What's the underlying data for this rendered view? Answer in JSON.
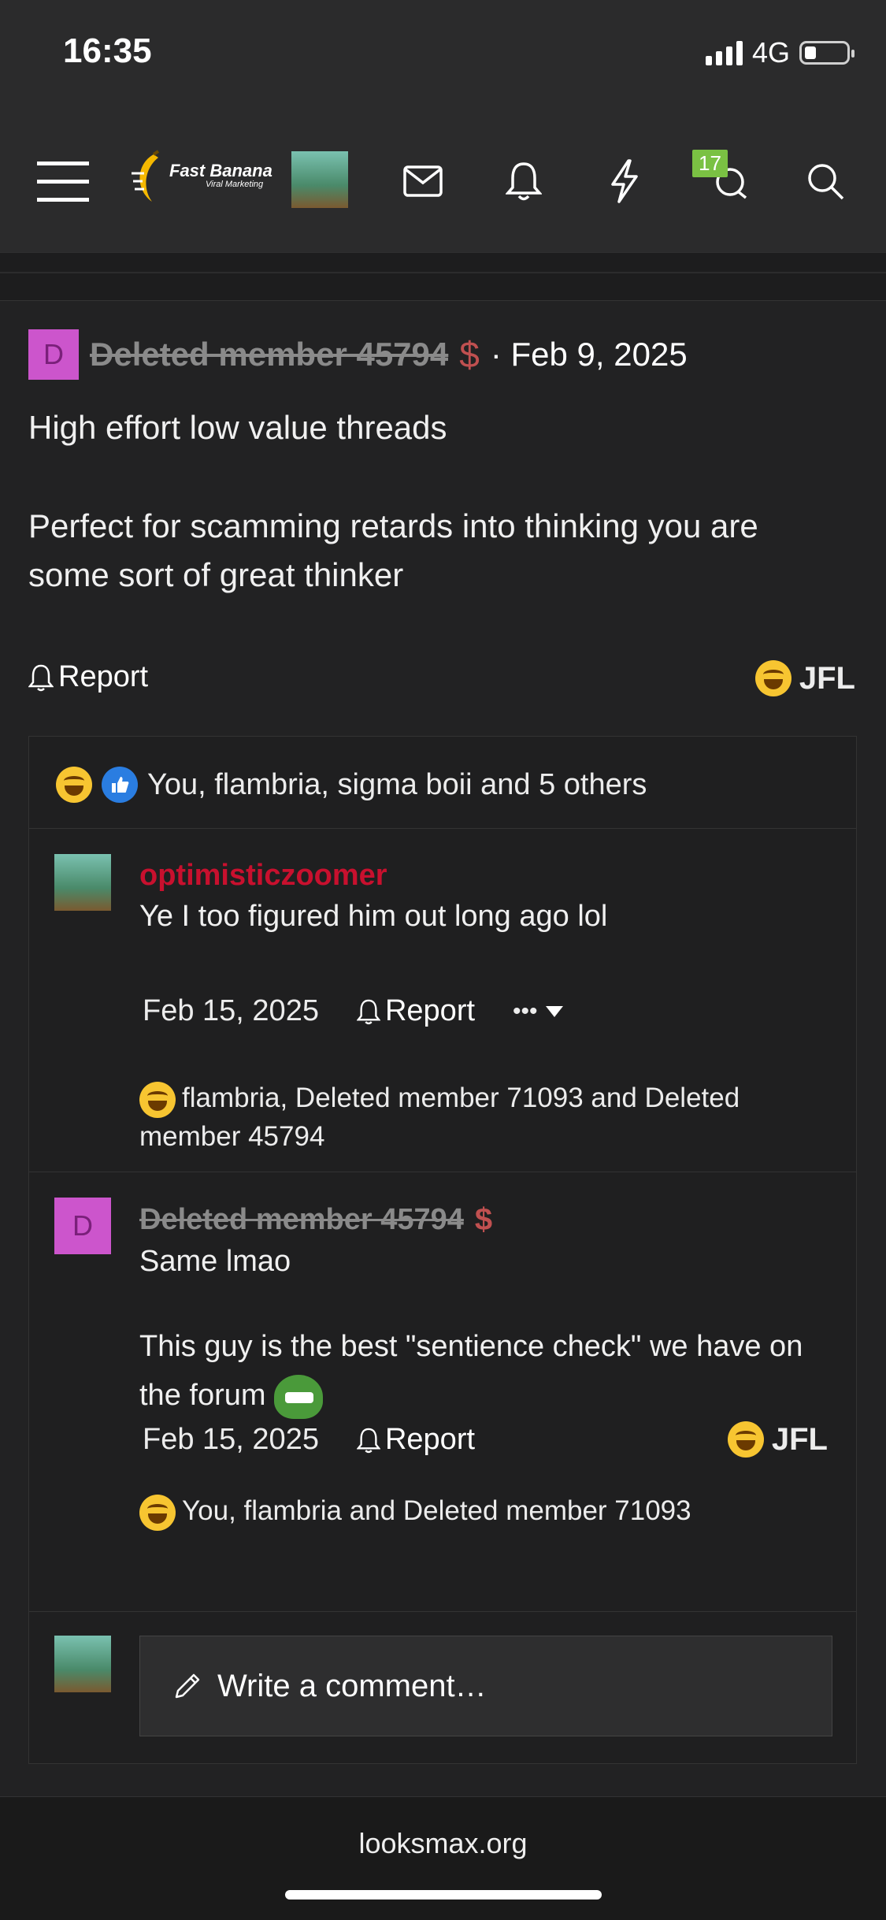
{
  "status_bar": {
    "time": "16:35",
    "network": "4G",
    "battery_percent": 25
  },
  "navbar": {
    "logo_line1": "Fast Banana",
    "logo_line2": "Viral Marketing",
    "notification_count": "17",
    "icons": [
      "menu-icon",
      "avatar",
      "mail-icon",
      "bell-icon",
      "lightning-icon",
      "chat-icon",
      "search-icon"
    ]
  },
  "post": {
    "author_initial": "D",
    "author": "Deleted member 45794",
    "dollar": "$",
    "date": "· Feb 9, 2025",
    "line1": "High effort low value threads",
    "line2": "Perfect for scamming retards into thinking you are some sort of great thinker",
    "report_label": "Report",
    "reaction_label": "JFL",
    "reactions_summary": "You, flambria, sigma boii and 5 others"
  },
  "comments": [
    {
      "author": "optimisticzoomer",
      "text": "Ye I too figured him out long ago lol",
      "date": "Feb 15, 2025",
      "report_label": "Report",
      "more_label": "•••",
      "reactions": "flambria, Deleted member 71093 and Deleted member 45794"
    },
    {
      "author_initial": "D",
      "author": "Deleted member 45794",
      "dollar": "$",
      "text1": "Same lmao",
      "text2": "This guy is the best \"sentience check\" we have on the forum",
      "date": "Feb 15, 2025",
      "report_label": "Report",
      "reaction_label": "JFL",
      "reactions": "You, flambria and Deleted member 71093"
    }
  ],
  "write_comment_placeholder": "Write a comment…",
  "footer_url": "looksmax.org",
  "colors": {
    "accent_red": "#c8102e",
    "badge_green": "#7ac143",
    "avatar_d": "#cc55cc"
  }
}
